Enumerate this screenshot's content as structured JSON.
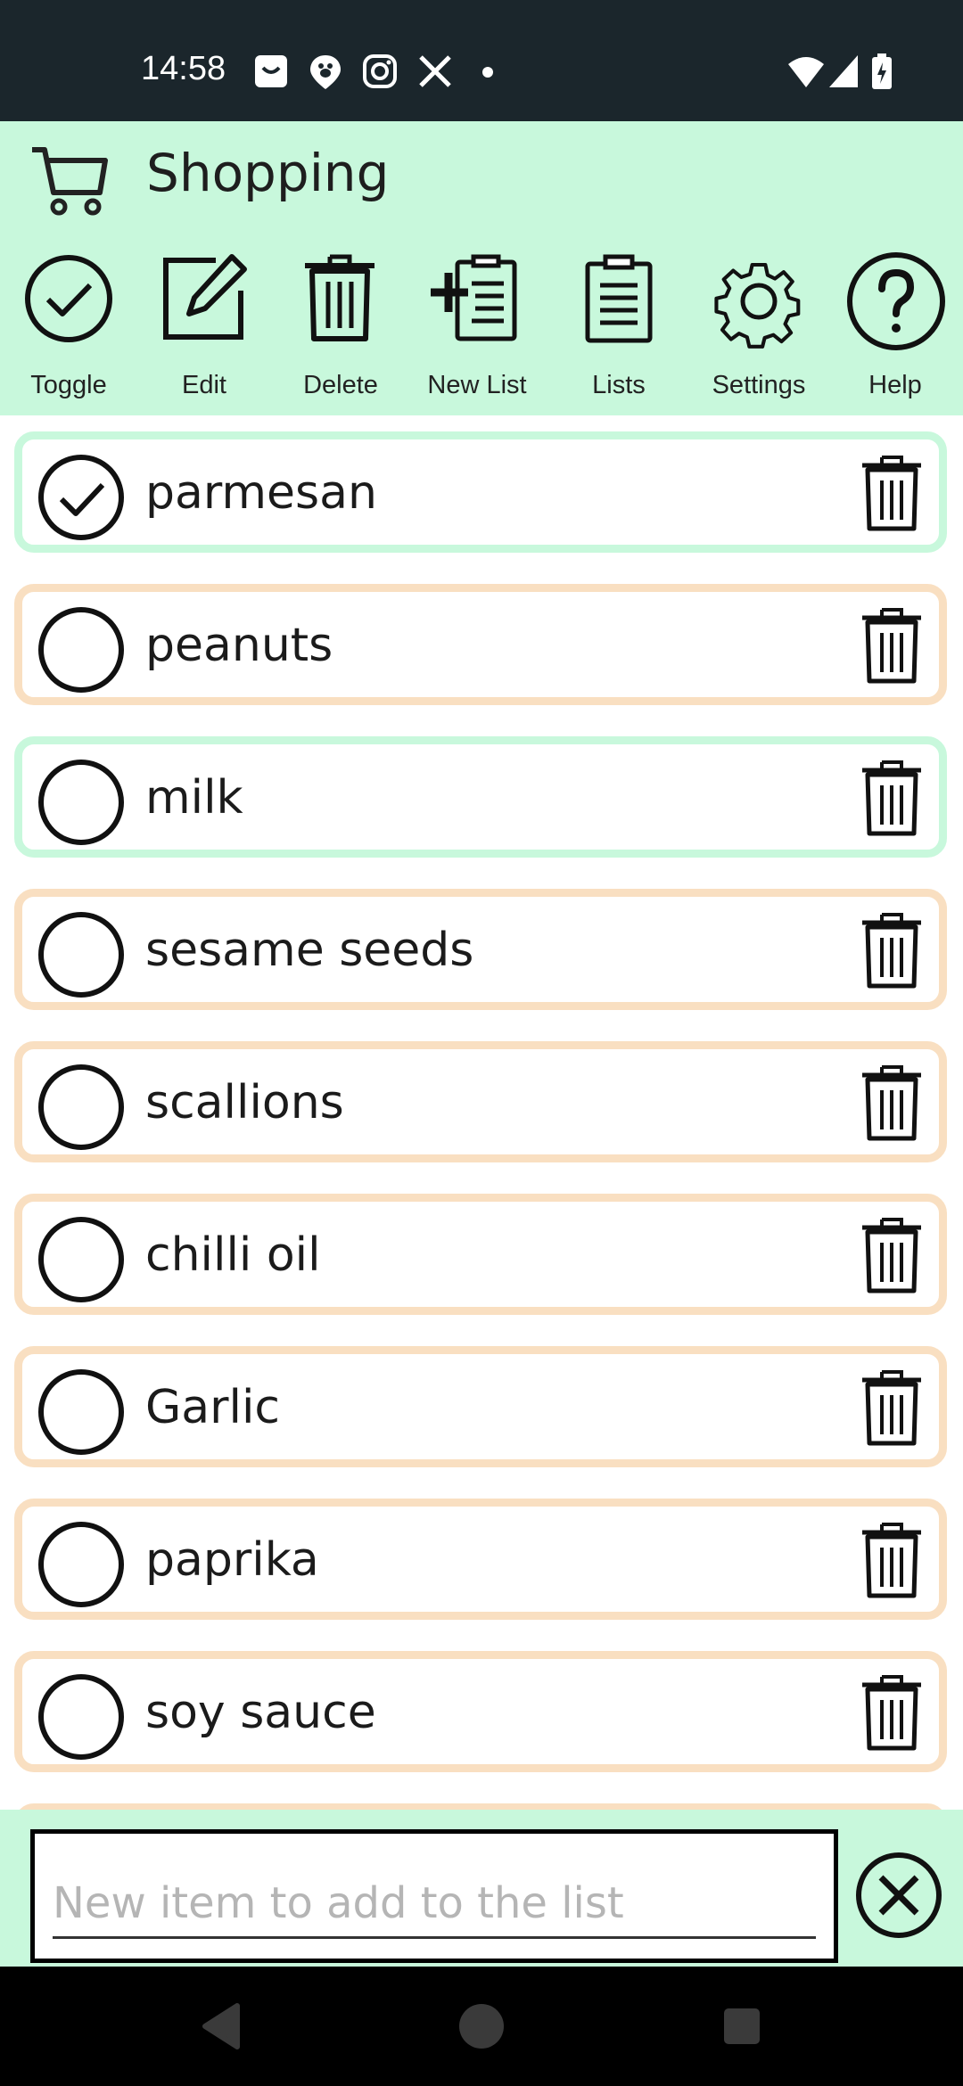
{
  "status_bar": {
    "time": "14:58",
    "notification_icons": [
      "bag-icon",
      "paw-map-icon",
      "instagram-icon",
      "x-icon",
      "dot-icon"
    ],
    "system_icons": [
      "wifi-icon",
      "cellular-icon",
      "battery-charging-icon"
    ]
  },
  "header": {
    "title": "Shopping",
    "icon": "cart-icon"
  },
  "toolbar": {
    "toggle_label": "Toggle",
    "edit_label": "Edit",
    "delete_label": "Delete",
    "new_list_label": "New List",
    "lists_label": "Lists",
    "settings_label": "Settings",
    "help_label": "Help"
  },
  "items": [
    {
      "label": "parmesan",
      "checked": true
    },
    {
      "label": "peanuts",
      "checked": false
    },
    {
      "label": "milk",
      "checked": false
    },
    {
      "label": "sesame seeds",
      "checked": false
    },
    {
      "label": "scallions",
      "checked": false
    },
    {
      "label": "chilli oil",
      "checked": false
    },
    {
      "label": "Garlic",
      "checked": false
    },
    {
      "label": "paprika",
      "checked": false
    },
    {
      "label": "soy sauce",
      "checked": false
    }
  ],
  "input": {
    "placeholder": "New item to add to the list",
    "value": ""
  },
  "colors": {
    "header_bg": "#c8f8dc",
    "status_bar_bg": "#1b262c",
    "item_border_unchecked": "#f9dfc1",
    "item_border_highlight": "#c8f8dc"
  }
}
